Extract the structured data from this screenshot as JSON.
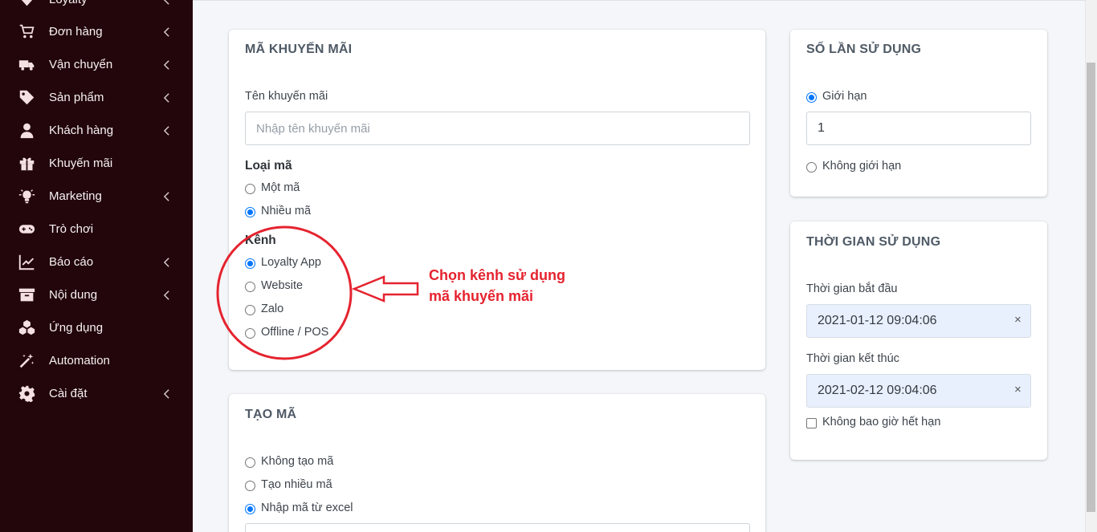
{
  "sidebar": {
    "items": [
      {
        "label": "Loyalty",
        "icon": "diamond-icon"
      },
      {
        "label": "Đơn hàng",
        "icon": "cart-icon"
      },
      {
        "label": "Vận chuyển",
        "icon": "truck-icon"
      },
      {
        "label": "Sản phẩm",
        "icon": "tag-icon"
      },
      {
        "label": "Khách hàng",
        "icon": "user-icon"
      },
      {
        "label": "Khuyến mãi",
        "icon": "gift-icon"
      },
      {
        "label": "Marketing",
        "icon": "lightbulb-icon"
      },
      {
        "label": "Trò chơi",
        "icon": "gamepad-icon"
      },
      {
        "label": "Báo cáo",
        "icon": "chart-line-icon"
      },
      {
        "label": "Nội dung",
        "icon": "archive-icon"
      },
      {
        "label": "Ứng dụng",
        "icon": "cubes-icon"
      },
      {
        "label": "Automation",
        "icon": "magic-wand-icon"
      },
      {
        "label": "Cài đặt",
        "icon": "gear-icon"
      }
    ]
  },
  "promo_card": {
    "title": "MÃ KHUYẾN MÃI",
    "name_label": "Tên khuyến mãi",
    "name_placeholder": "Nhập tên khuyến mãi",
    "code_type_label": "Loại mã",
    "code_type_options": [
      "Một mã",
      "Nhiều mã"
    ],
    "code_type_selected": "Nhiều mã",
    "channel_label": "Kênh",
    "channel_options": [
      "Loyalty App",
      "Website",
      "Zalo",
      "Offline / POS"
    ],
    "channel_selected": "Loyalty App"
  },
  "annotation": {
    "line1": "Chọn kênh sử dụng",
    "line2": "mã khuyến mãi",
    "color": "#e5232f"
  },
  "create_card": {
    "title": "TẠO MÃ",
    "options": [
      "Không tạo mã",
      "Tạo nhiều mã",
      "Nhập mã từ excel"
    ],
    "selected": "Nhập mã từ excel"
  },
  "usage_card": {
    "title": "SỐ LẦN SỬ DỤNG",
    "limit_label": "Giới hạn",
    "limit_value": "1",
    "unlimited_label": "Không giới hạn",
    "selected": "Giới hạn"
  },
  "time_card": {
    "title": "THỜI GIAN SỬ DỤNG",
    "start_label": "Thời gian bắt đầu",
    "start_value": "2021-01-12 09:04:06",
    "end_label": "Thời gian kết thúc",
    "end_value": "2021-02-12 09:04:06",
    "clear_symbol": "×",
    "never_expire_label": "Không bao giờ hết hạn",
    "never_expire_checked": false
  },
  "colors": {
    "sidebar_bg": "#22060b",
    "accent_radio": "#0075ff"
  }
}
